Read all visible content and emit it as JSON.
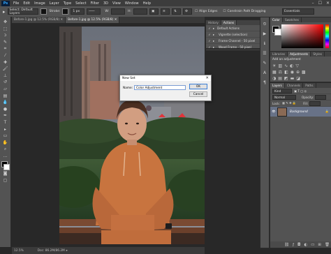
{
  "app": {
    "logo": "Ps",
    "menu": [
      "File",
      "Edit",
      "Image",
      "Layer",
      "Type",
      "Select",
      "Filter",
      "3D",
      "View",
      "Window",
      "Help"
    ],
    "window_controls": [
      "–",
      "☐",
      "✕"
    ]
  },
  "options_bar": {
    "select_label": "Select: Default Layers",
    "stroke_label": "Stroke:",
    "stroke_value": "1 px",
    "align_edges": "Align Edges",
    "constrain_paths": "Constrain Path Dragging",
    "workspace": "Essentials"
  },
  "tabs": [
    {
      "label": "Before-1.jpg @ 12.5% (RGB/8) ✕",
      "active": false
    },
    {
      "label": "Before-1.jpg @ 12.5% (RGB/8) ✕",
      "active": true
    }
  ],
  "status": {
    "zoom": "12.5%",
    "doc": "Doc: 86.2M/86.2M"
  },
  "actions_panel": {
    "tabs": [
      "History",
      "Actions"
    ],
    "items": [
      "Default Actions",
      "Vignette (selection)",
      "Frame Channel - 50 pixel",
      "Wood Frame - 50 pixel"
    ]
  },
  "color_panel": {
    "tabs": [
      "Color",
      "Swatches"
    ]
  },
  "adjustments_panel": {
    "tabs": [
      "Libraries",
      "Adjustments",
      "Styles"
    ],
    "heading": "Add an adjustment"
  },
  "layers_panel": {
    "tabs": [
      "Layers",
      "Channels",
      "Paths"
    ],
    "kind": "Kind",
    "blend_mode": "Normal",
    "opacity_label": "Opacity:",
    "fill_label": "Fill:",
    "lock_label": "Lock:",
    "layer_name": "Background"
  },
  "dialog": {
    "title": "New Set",
    "close": "✕",
    "name_label": "Name:",
    "name_value": "Color Adjustment",
    "ok_label": "OK",
    "cancel_label": "Cancel"
  },
  "colors": {
    "panel_bg": "#535353",
    "app_bg": "#282828",
    "accent": "#31a8ff",
    "hoodie": "#c8743f"
  }
}
